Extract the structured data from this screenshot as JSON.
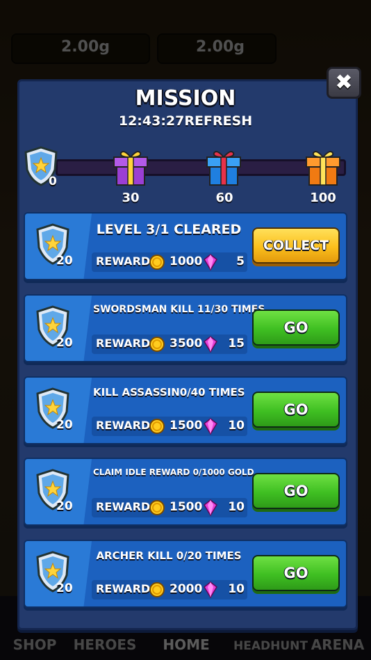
{
  "background": {
    "gold_balance": "2.00g",
    "gem_balance": "2.00g",
    "nav": [
      "SHOP",
      "HEROES",
      "HOME",
      "HEADHUNT",
      "ARENA"
    ]
  },
  "modal": {
    "title": "MISSION",
    "refresh": "12:43:27REFRESH",
    "progress": {
      "current": "0",
      "current_value": 0,
      "max_value": 100,
      "milestones": [
        {
          "label": "30",
          "color": "purple"
        },
        {
          "label": "60",
          "color": "blue"
        },
        {
          "label": "100",
          "color": "orange"
        }
      ]
    },
    "missions": [
      {
        "title": "LEVEL 3/1 CLEARED",
        "points": "20",
        "reward_label": "REWARD",
        "gold": "1000",
        "gems": "5",
        "button": "COLLECT",
        "button_style": "collect"
      },
      {
        "title": "SWORDSMAN KILL 11/30 TIMES",
        "points": "20",
        "reward_label": "REWARD",
        "gold": "3500",
        "gems": "15",
        "button": "GO",
        "button_style": "go"
      },
      {
        "title": "KILL ASSASSIN0/40 TIMES",
        "points": "20",
        "reward_label": "REWARD",
        "gold": "1500",
        "gems": "10",
        "button": "GO",
        "button_style": "go"
      },
      {
        "title": "CLAIM IDLE REWARD 0/1000 GOLD",
        "points": "20",
        "reward_label": "REWARD",
        "gold": "1500",
        "gems": "10",
        "button": "GO",
        "button_style": "go"
      },
      {
        "title": "ARCHER KILL 0/20 TIMES",
        "points": "20",
        "reward_label": "REWARD",
        "gold": "2000",
        "gems": "10",
        "button": "GO",
        "button_style": "go"
      }
    ]
  },
  "colors": {
    "modal_bg": "#233a6c",
    "card_bg": "#1c61bf",
    "go_button": "#3fbf22",
    "collect_button": "#fbbf1c"
  }
}
